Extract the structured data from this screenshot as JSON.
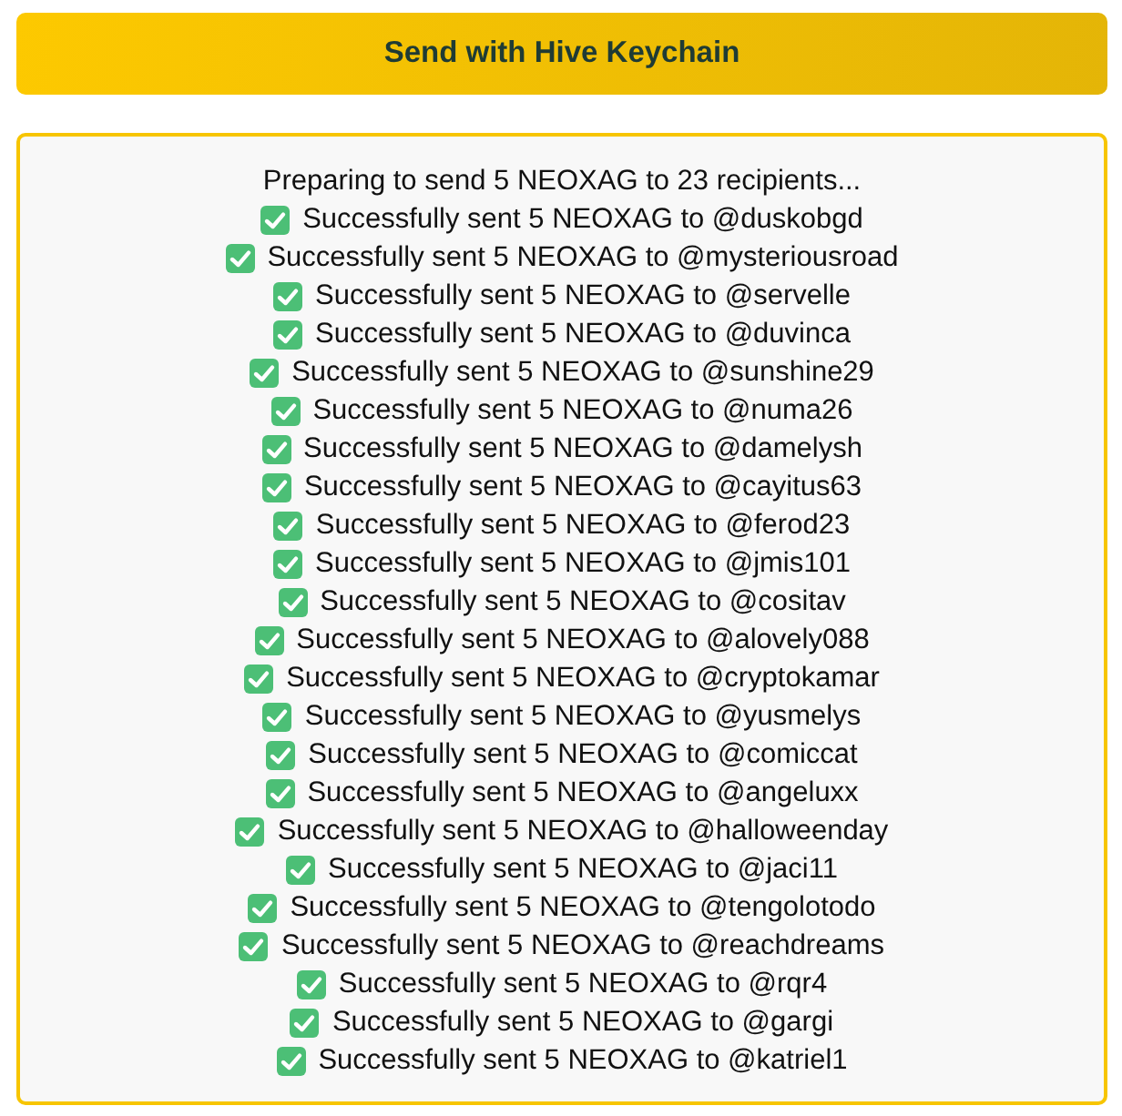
{
  "send_button": {
    "label": "Send with Hive Keychain"
  },
  "log": [
    {
      "kind": "info",
      "text": "Preparing to send 5 NEOXAG to 23 recipients..."
    },
    {
      "kind": "success",
      "text": "Successfully sent 5 NEOXAG to @duskobgd"
    },
    {
      "kind": "success",
      "text": "Successfully sent 5 NEOXAG to @mysteriousroad"
    },
    {
      "kind": "success",
      "text": "Successfully sent 5 NEOXAG to @servelle"
    },
    {
      "kind": "success",
      "text": "Successfully sent 5 NEOXAG to @duvinca"
    },
    {
      "kind": "success",
      "text": "Successfully sent 5 NEOXAG to @sunshine29"
    },
    {
      "kind": "success",
      "text": "Successfully sent 5 NEOXAG to @numa26"
    },
    {
      "kind": "success",
      "text": "Successfully sent 5 NEOXAG to @damelysh"
    },
    {
      "kind": "success",
      "text": "Successfully sent 5 NEOXAG to @cayitus63"
    },
    {
      "kind": "success",
      "text": "Successfully sent 5 NEOXAG to @ferod23"
    },
    {
      "kind": "success",
      "text": "Successfully sent 5 NEOXAG to @jmis101"
    },
    {
      "kind": "success",
      "text": "Successfully sent 5 NEOXAG to @cositav"
    },
    {
      "kind": "success",
      "text": "Successfully sent 5 NEOXAG to @alovely088"
    },
    {
      "kind": "success",
      "text": "Successfully sent 5 NEOXAG to @cryptokamar"
    },
    {
      "kind": "success",
      "text": "Successfully sent 5 NEOXAG to @yusmelys"
    },
    {
      "kind": "success",
      "text": "Successfully sent 5 NEOXAG to @comiccat"
    },
    {
      "kind": "success",
      "text": "Successfully sent 5 NEOXAG to @angeluxx"
    },
    {
      "kind": "success",
      "text": "Successfully sent 5 NEOXAG to @halloweenday"
    },
    {
      "kind": "success",
      "text": "Successfully sent 5 NEOXAG to @jaci11"
    },
    {
      "kind": "success",
      "text": "Successfully sent 5 NEOXAG to @tengolotodo"
    },
    {
      "kind": "success",
      "text": "Successfully sent 5 NEOXAG to @reachdreams"
    },
    {
      "kind": "success",
      "text": "Successfully sent 5 NEOXAG to @rqr4"
    },
    {
      "kind": "success",
      "text": "Successfully sent 5 NEOXAG to @gargi"
    },
    {
      "kind": "success",
      "text": "Successfully sent 5 NEOXAG to @katriel1"
    }
  ]
}
